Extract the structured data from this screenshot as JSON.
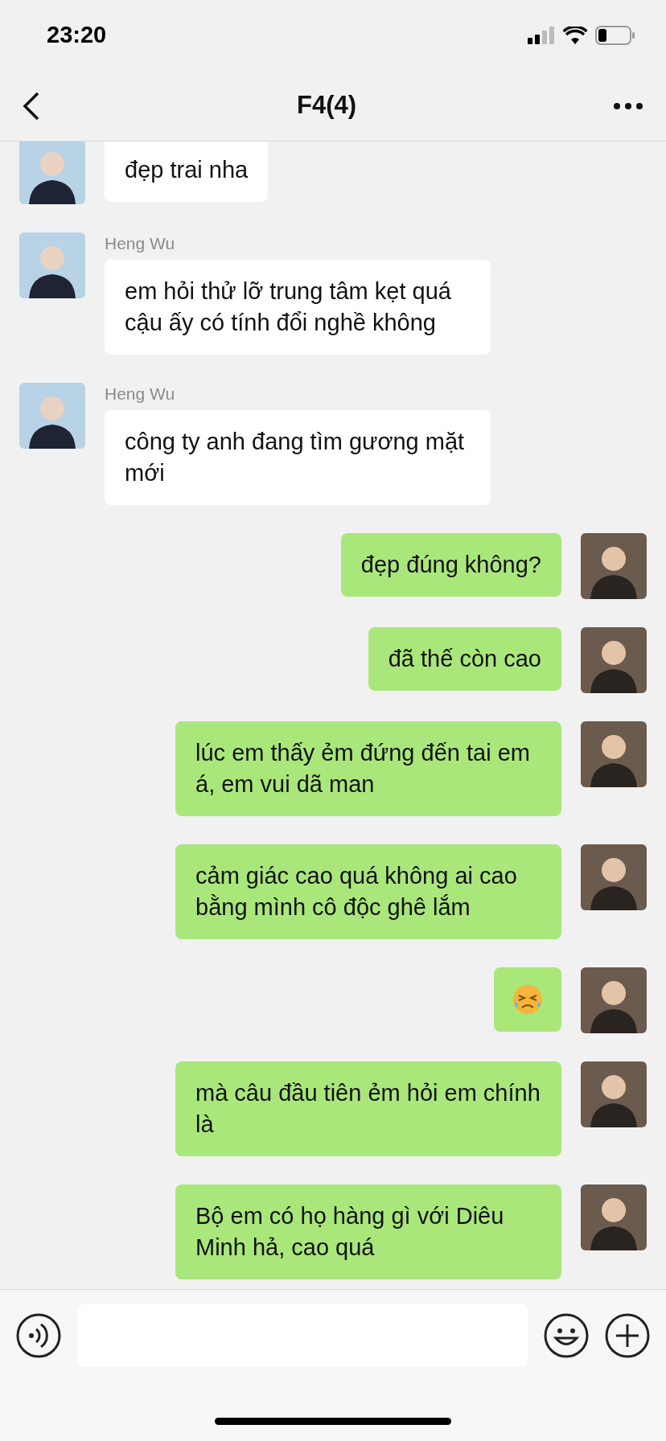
{
  "status_bar": {
    "time": "23:20"
  },
  "header": {
    "title": "F4(4)"
  },
  "messages": [
    {
      "outgoing": false,
      "kind": "text",
      "text": "đẹp trai nha"
    },
    {
      "outgoing": false,
      "kind": "text",
      "sender": "Heng Wu",
      "text": "em hỏi thử lỡ trung tâm kẹt quá cậu ấy có tính đổi nghề không"
    },
    {
      "outgoing": false,
      "kind": "text",
      "sender": "Heng Wu",
      "text": "công ty anh đang tìm gương mặt mới"
    },
    {
      "outgoing": true,
      "kind": "text",
      "text": "đẹp đúng không?"
    },
    {
      "outgoing": true,
      "kind": "text",
      "text": "đã thế còn cao"
    },
    {
      "outgoing": true,
      "kind": "text",
      "text": "lúc em thấy ẻm đứng đến tai em á, em vui dã man"
    },
    {
      "outgoing": true,
      "kind": "text",
      "text": "cảm giác cao quá không ai cao bằng mình cô độc ghê lắm"
    },
    {
      "outgoing": true,
      "kind": "emoji"
    },
    {
      "outgoing": true,
      "kind": "text",
      "text": "mà câu đầu tiên ẻm hỏi em chính là"
    },
    {
      "outgoing": true,
      "kind": "text",
      "text": "Bộ em có họ hàng gì với Diêu Minh hả, cao quá"
    }
  ]
}
